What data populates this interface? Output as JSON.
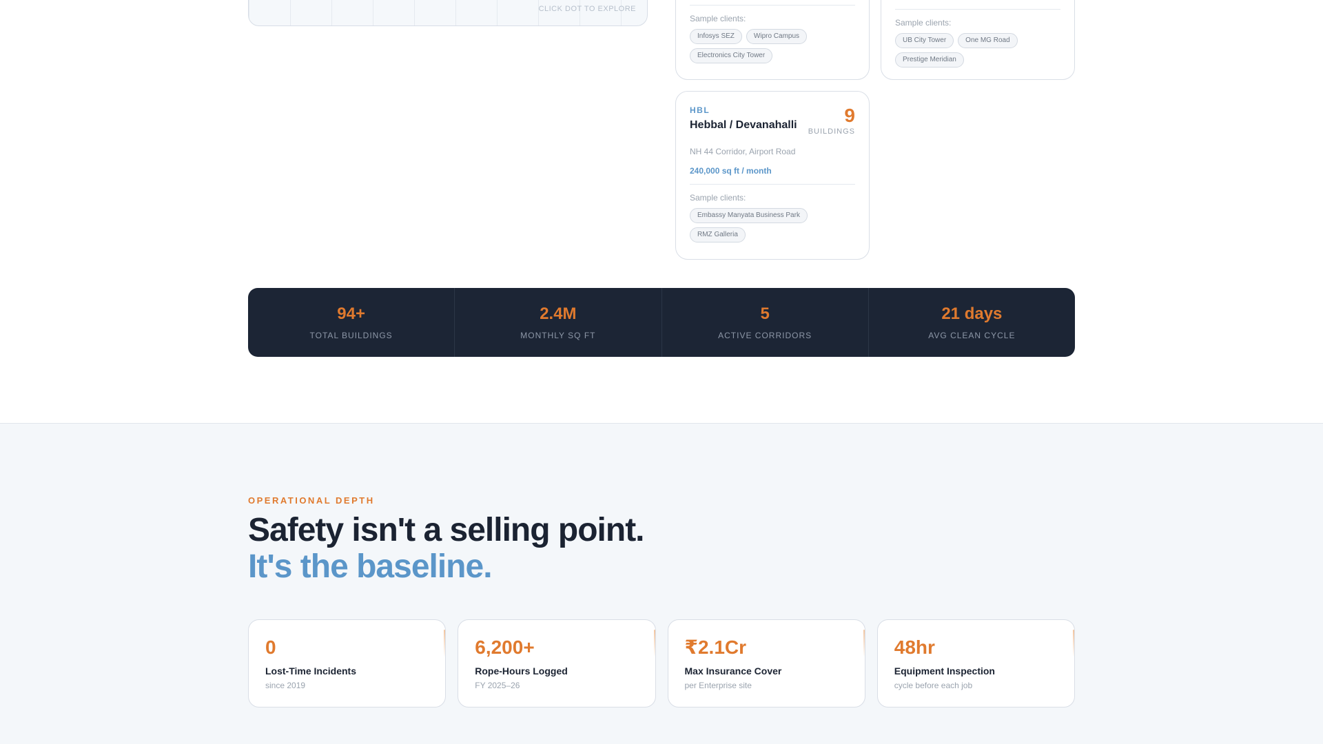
{
  "map": {
    "hint": "CLICK DOT TO EXPLORE"
  },
  "regions": [
    {
      "clients_label": "Sample clients:",
      "clients": [
        "Infosys SEZ",
        "Wipro Campus",
        "Electronics City Tower"
      ]
    },
    {
      "clients_label": "Sample clients:",
      "clients": [
        "UB City Tower",
        "One MG Road",
        "Prestige Meridian"
      ]
    },
    {
      "code": "HBL",
      "name": "Hebbal / Devanahalli",
      "count": "9",
      "count_label": "BUILDINGS",
      "address": "NH 44 Corridor, Airport Road",
      "volume": "240,000 sq ft / month",
      "clients_label": "Sample clients:",
      "clients": [
        "Embassy Manyata Business Park",
        "RMZ Galleria"
      ]
    }
  ],
  "stats": [
    {
      "value": "94+",
      "label": "TOTAL BUILDINGS"
    },
    {
      "value": "2.4M",
      "label": "MONTHLY SQ FT"
    },
    {
      "value": "5",
      "label": "ACTIVE CORRIDORS"
    },
    {
      "value": "21 days",
      "label": "AVG CLEAN CYCLE"
    }
  ],
  "section": {
    "eyebrow": "OPERATIONAL DEPTH",
    "heading_line1": "Safety isn't a selling point.",
    "heading_line2": "It's the baseline."
  },
  "metrics": [
    {
      "value": "0",
      "title": "Lost-Time Incidents",
      "sub": "since 2019"
    },
    {
      "value": "6,200+",
      "title": "Rope-Hours Logged",
      "sub": "FY 2025–26"
    },
    {
      "value": "₹2.1Cr",
      "title": "Max Insurance Cover",
      "sub": "per Enterprise site"
    },
    {
      "value": "48hr",
      "title": "Equipment Inspection",
      "sub": "cycle before each job"
    }
  ],
  "colors": {
    "accent_orange": "#e07a2e",
    "accent_blue": "#5b96c9",
    "dark_band": "#1c2535"
  }
}
